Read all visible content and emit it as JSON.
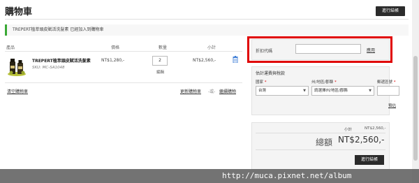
{
  "header": {
    "title": "購物車",
    "checkout_label": "進行結帳"
  },
  "notice": {
    "text": "TREPERT植萃頭皮賦活洗髮素 已經加入到購物車"
  },
  "cart": {
    "columns": [
      "產品",
      "價格",
      "數量",
      "小計"
    ],
    "items": [
      {
        "name": "TREPERT植萃頭皮賦活洗髮素",
        "sku": "SKU: MC-SA1048",
        "price": "NT$1,280,-",
        "qty": "2",
        "edit": "編輯",
        "subtotal": "NT$2,560,-"
      }
    ],
    "actions": {
      "empty": "清空購物車",
      "update": "更新購物車",
      "separator": "-或-",
      "continue": "繼續購物"
    }
  },
  "coupon": {
    "label": "折扣代碼",
    "apply": "應用"
  },
  "shipping": {
    "title": "估計運費與稅款",
    "country_label": "國家",
    "state_label": "州/地區/郡縣",
    "zip_label": "郵遞區號",
    "country_value": "台灣",
    "state_value": "請選擇州/地區/郡縣",
    "estimate": "預估"
  },
  "summary": {
    "subtotal_label": "小計",
    "subtotal_value": "NT$2,560,-",
    "total_label": "總額",
    "total_value": "NT$2,560,-",
    "checkout_label": "進行結帳"
  },
  "watermark": "http://muca.pixnet.net/album",
  "colors": {
    "accent_green": "#3aa935",
    "highlight_red": "#e00000",
    "button_dark": "#2b2b2b"
  }
}
